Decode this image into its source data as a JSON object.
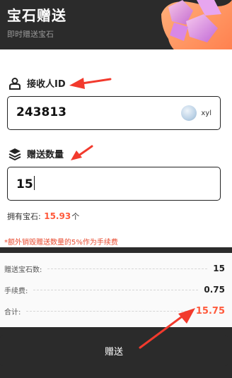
{
  "header": {
    "title": "宝石赠送",
    "subtitle": "即时赠送宝石",
    "art_icon": "gem-cluster-icon"
  },
  "receiver": {
    "label": "接收人ID",
    "icon": "person-icon",
    "value": "243813",
    "avatar_icon": "avatar",
    "username": "xyl"
  },
  "amount": {
    "label": "赠送数量",
    "icon": "layers-icon",
    "value": "15"
  },
  "balance": {
    "label": "拥有宝石:",
    "value": "15.93",
    "unit": "个"
  },
  "notice": "*额外销毁赠送数量的5%作为手续费",
  "summary": {
    "rows": [
      {
        "label": "赠送宝石数:",
        "value": "15"
      },
      {
        "label": "手续费:",
        "value": "0.75"
      },
      {
        "label": "合计:",
        "value": "15.75"
      }
    ]
  },
  "submit_label": "赠送",
  "colors": {
    "accent": "#ff5a3c",
    "dark": "#2b2b2b",
    "arrow": "#f23a2d"
  }
}
